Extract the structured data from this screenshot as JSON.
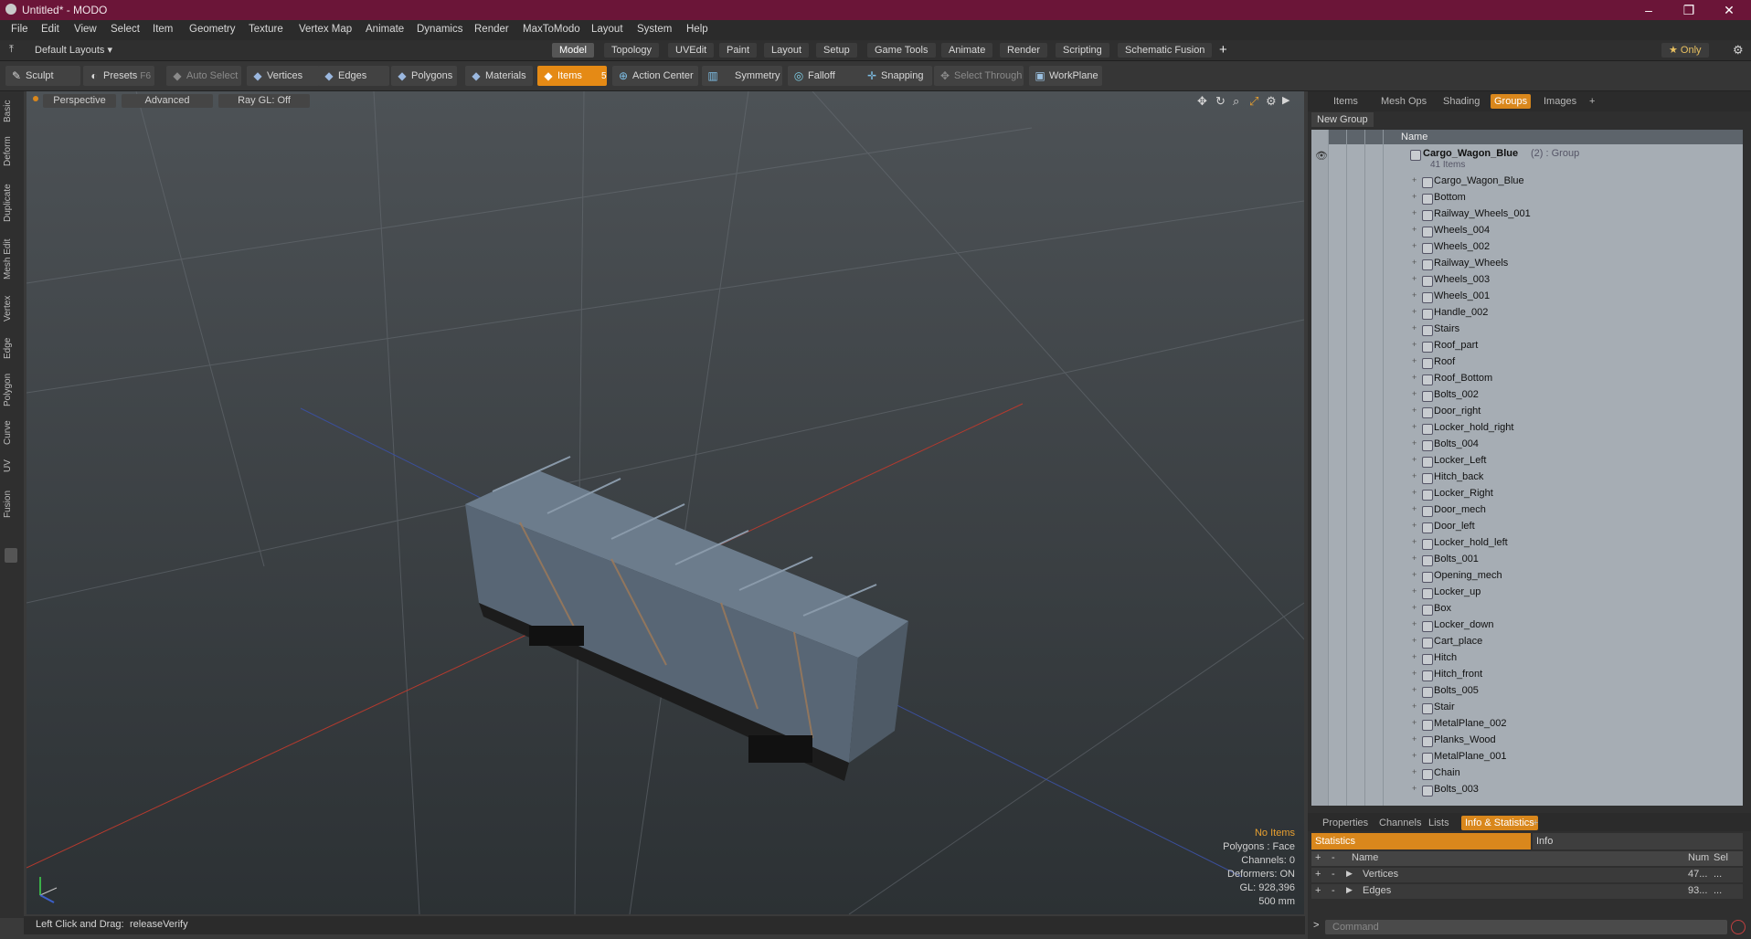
{
  "window": {
    "title": "Untitled* - MODO",
    "controls": [
      "–",
      "❐",
      "✕"
    ]
  },
  "menubar": {
    "items": [
      "File",
      "Edit",
      "View",
      "Select",
      "Item",
      "Geometry",
      "Texture",
      "Vertex Map",
      "Animate",
      "Dynamics",
      "Render",
      "MaxToModo",
      "Layout",
      "System",
      "Help"
    ]
  },
  "layoutbar": {
    "layout_dropdown": "Default Layouts ▾",
    "tabs": [
      "Model",
      "Topology",
      "UVEdit",
      "Paint",
      "Layout",
      "Setup",
      "Game Tools",
      "Animate",
      "Render",
      "Scripting",
      "Schematic Fusion"
    ],
    "active_tab": "Model",
    "add_tab": "+",
    "only_label": "★ Only"
  },
  "toolbar": {
    "sculpt": "Sculpt",
    "presets": "Presets",
    "presets_key": "F6",
    "auto_select": "Auto Select",
    "vertices": "Vertices",
    "vertices_count": "1",
    "edges": "Edges",
    "edges_count": "2",
    "polygons": "Polygons",
    "materials": "Materials",
    "items": "Items",
    "items_count": "5",
    "action_center": "Action Center",
    "symmetry": "Symmetry",
    "falloff": "Falloff",
    "snapping": "Snapping",
    "select_through": "Select Through",
    "workplane": "WorkPlane"
  },
  "left_tabs": [
    "Basic",
    "Deform",
    "Duplicate",
    "Mesh Edit",
    "Vertex",
    "Edge",
    "Polygon",
    "Curve",
    "UV",
    "Fusion"
  ],
  "viewport": {
    "perspective": "Perspective",
    "advanced": "Advanced",
    "raygl": "Ray GL: Off",
    "info": {
      "no_items": "No Items",
      "polygons": "Polygons : Face",
      "channels": "Channels: 0",
      "deformers": "Deformers: ON",
      "gl": "GL: 928,396",
      "scale": "500 mm"
    }
  },
  "statusbar": {
    "hint": "Left Click and Drag:",
    "action": "releaseVerify"
  },
  "right_panel": {
    "tabs": [
      "Items",
      "Mesh Ops",
      "Shading",
      "Groups",
      "Images",
      "+"
    ],
    "active_tab": "Groups",
    "new_group": "New Group",
    "name_header": "Name",
    "group_name": "Cargo_Wagon_Blue",
    "group_suffix": "(2) : Group",
    "group_count": "41 Items",
    "items": [
      "Cargo_Wagon_Blue",
      "Bottom",
      "Railway_Wheels_001",
      "Wheels_004",
      "Wheels_002",
      "Railway_Wheels",
      "Wheels_003",
      "Wheels_001",
      "Handle_002",
      "Stairs",
      "Roof_part",
      "Roof",
      "Roof_Bottom",
      "Bolts_002",
      "Door_right",
      "Locker_hold_right",
      "Bolts_004",
      "Locker_Left",
      "Hitch_back",
      "Locker_Right",
      "Door_mech",
      "Door_left",
      "Locker_hold_left",
      "Bolts_001",
      "Opening_mech",
      "Locker_up",
      "Box",
      "Locker_down",
      "Cart_place",
      "Hitch",
      "Hitch_front",
      "Bolts_005",
      "Stair",
      "MetalPlane_002",
      "Planks_Wood",
      "MetalPlane_001",
      "Chain",
      "Bolts_003"
    ]
  },
  "bottom_panel": {
    "tabs": [
      "Properties",
      "Channels",
      "Lists",
      "Info & Statistics",
      "+"
    ],
    "active_tab": "Info & Statistics",
    "statistics": "Statistics",
    "info": "Info",
    "col_name": "Name",
    "col_num": "Num",
    "col_sel": "Sel",
    "rows": [
      {
        "name": "Vertices",
        "num": "47...",
        "sel": "..."
      },
      {
        "name": "Edges",
        "num": "93...",
        "sel": "..."
      }
    ],
    "command_placeholder": "Command"
  },
  "colors": {
    "titlebar": "#6b1538",
    "accent": "#e58a15",
    "list_bg": "#a6adb4"
  }
}
